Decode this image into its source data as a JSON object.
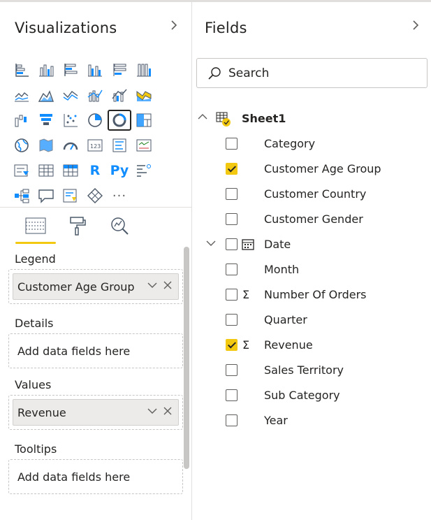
{
  "visualizations": {
    "title": "Visualizations",
    "collapse_icon": "chevron-right-icon",
    "icons": [
      [
        "stacked-bar-chart-icon",
        "stacked-column-chart-icon",
        "clustered-bar-chart-icon",
        "clustered-column-chart-icon",
        "100-stacked-bar-chart-icon",
        "100-stacked-column-chart-icon"
      ],
      [
        "line-chart-icon",
        "area-chart-icon",
        "stacked-area-chart-icon",
        "line-and-stacked-column-chart-icon",
        "line-and-clustered-column-chart-icon",
        "ribbon-chart-icon"
      ],
      [
        "waterfall-chart-icon",
        "funnel-icon",
        "scatter-chart-icon",
        "pie-chart-icon",
        "donut-chart-icon",
        "treemap-icon"
      ],
      [
        "map-icon",
        "filled-map-icon",
        "gauge-icon",
        "card-icon",
        "multi-row-card-icon",
        "kpi-icon"
      ],
      [
        "slicer-icon",
        "table-icon",
        "matrix-icon",
        "r-script-visual-icon",
        "python-visual-icon",
        "key-influencers-icon"
      ],
      [
        "decomposition-tree-icon",
        "qa-icon",
        "smart-narrative-icon",
        "power-apps-icon",
        "more-visuals-icon"
      ]
    ],
    "r_label": "R",
    "py_label": "Py",
    "more_label": "···",
    "subtabs": [
      "fields-tab-icon",
      "format-tab-icon",
      "analytics-tab-icon"
    ],
    "wells": {
      "legend": {
        "label": "Legend",
        "value": "Customer Age Group"
      },
      "details": {
        "label": "Details",
        "placeholder": "Add data fields here"
      },
      "values": {
        "label": "Values",
        "value": "Revenue"
      },
      "tooltips": {
        "label": "Tooltips",
        "placeholder": "Add data fields here"
      }
    },
    "pill_actions": {
      "expand": "∨",
      "remove": "×"
    }
  },
  "fields": {
    "title": "Fields",
    "collapse_icon": "chevron-right-icon",
    "search_placeholder": "Search",
    "table": {
      "name": "Sheet1",
      "expanded": true
    },
    "items": [
      {
        "label": "Category",
        "checked": false
      },
      {
        "label": "Customer Age Group",
        "checked": true
      },
      {
        "label": "Customer Country",
        "checked": false
      },
      {
        "label": "Customer Gender",
        "checked": false
      },
      {
        "label": "Date",
        "checked": false,
        "type": "date-hierarchy"
      },
      {
        "label": "Month",
        "checked": false
      },
      {
        "label": "Number Of Orders",
        "checked": false,
        "type": "sum"
      },
      {
        "label": "Quarter",
        "checked": false
      },
      {
        "label": "Revenue",
        "checked": true,
        "type": "sum"
      },
      {
        "label": "Sales Territory",
        "checked": false
      },
      {
        "label": "Sub Category",
        "checked": false
      },
      {
        "label": "Year",
        "checked": false
      }
    ],
    "sigma_symbol": "Σ"
  },
  "colors": {
    "accent": "#f2c811",
    "brand_blue": "#118dff"
  }
}
